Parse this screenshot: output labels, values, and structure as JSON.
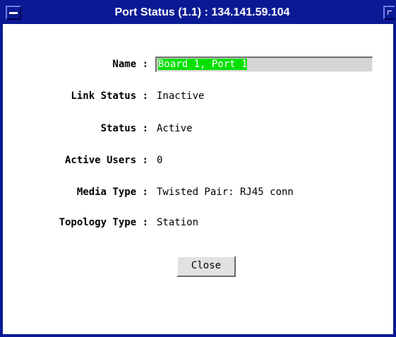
{
  "window": {
    "title": "Port Status (1.1) : 134.141.59.104"
  },
  "fields": {
    "name": {
      "label": "Name :",
      "value": "Board 1, Port 1"
    },
    "link_status": {
      "label": "Link Status :",
      "value": "Inactive"
    },
    "status": {
      "label": "Status :",
      "value": "Active"
    },
    "active_users": {
      "label": "Active Users :",
      "value": "0"
    },
    "media_type": {
      "label": "Media Type :",
      "value": "Twisted Pair: RJ45 conn"
    },
    "topology_type": {
      "label": "Topology Type :",
      "value": "Station"
    }
  },
  "buttons": {
    "close_label": "Close"
  },
  "colors": {
    "titlebar": "#0a1a94",
    "selection": "#00e000",
    "field_bg": "#d6d6d6",
    "button_bg": "#e2e2e2"
  },
  "icons": {
    "window_menu": "window-menu-icon",
    "resize": "maximize-icon"
  }
}
